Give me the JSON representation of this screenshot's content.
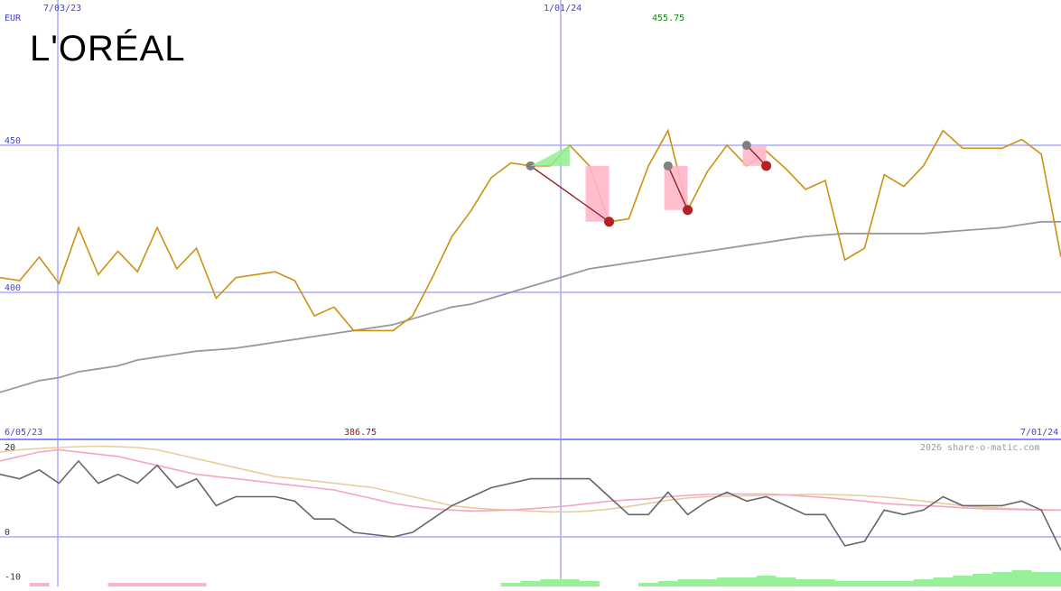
{
  "chart_data": [
    {
      "type": "line",
      "name": "price_panel",
      "currency_label": "EUR",
      "logo_text": "L'ORÉAL",
      "top_date_labels": [
        "7/03/23",
        "1/01/24"
      ],
      "high_label": "455.75",
      "low_label": "386.75",
      "range_start_label": "6/05/23",
      "range_end_label": "7/01/24",
      "y_ticks": [
        450,
        400
      ],
      "ylim": [
        380,
        470
      ],
      "xlim": [
        0,
        55
      ],
      "grid": true,
      "series": [
        {
          "values": [
            405,
            404,
            412,
            403,
            422,
            406,
            414,
            407,
            422,
            408,
            415,
            398,
            405,
            406,
            407,
            404,
            392,
            395,
            387,
            387,
            387,
            392,
            405,
            419,
            428,
            439,
            444,
            443,
            443,
            450,
            443,
            424,
            425,
            443,
            455,
            428,
            441,
            450,
            443,
            448,
            442,
            435,
            438,
            411,
            415,
            440,
            436,
            443,
            455,
            449,
            449,
            449,
            452,
            447,
            412
          ],
          "color": "#cc9111"
        },
        {
          "values": [
            366,
            368,
            370,
            371,
            373,
            374,
            375,
            377,
            378,
            379,
            380,
            380.5,
            381,
            382,
            383,
            384,
            385,
            386,
            387,
            388,
            389,
            391,
            393,
            395,
            396,
            398,
            400,
            402,
            404,
            406,
            408,
            409,
            410,
            411,
            412,
            413,
            414,
            415,
            416,
            417,
            418,
            419,
            419.5,
            420,
            420,
            420,
            420,
            420,
            420.5,
            421,
            421.5,
            422,
            423,
            424,
            424
          ],
          "color": "#999999"
        }
      ],
      "annotations": {
        "pairs": [
          {
            "from_index": 27,
            "to_index": 31,
            "from_value": 443,
            "to_value": 424
          },
          {
            "from_index": 34,
            "to_index": 35,
            "from_value": 443,
            "to_value": 428
          },
          {
            "from_index": 38,
            "to_index": 39,
            "from_value": 450,
            "to_value": 443
          }
        ]
      },
      "watermark": "2026 share-o-matic.com"
    },
    {
      "type": "line",
      "name": "oscillator_panel",
      "y_ticks": [
        20,
        0,
        -10
      ],
      "ylim": [
        -11,
        21
      ],
      "xlim": [
        0,
        55
      ],
      "grid": true,
      "series": [
        {
          "color": "#666666",
          "values": [
            14,
            13,
            15,
            12,
            17,
            12,
            14,
            12,
            16,
            11,
            13,
            7,
            9,
            9,
            9,
            8,
            4,
            4,
            1,
            0.5,
            0,
            1,
            4,
            7,
            9,
            11,
            12,
            13,
            13,
            13,
            13,
            9,
            5,
            5,
            10,
            5,
            8,
            10,
            8,
            9,
            7,
            5,
            5,
            -2,
            -1,
            6,
            5,
            6,
            9,
            7,
            7,
            7,
            8,
            6,
            -3
          ]
        },
        {
          "color": "#f4a6c0",
          "values": [
            17,
            18,
            19,
            19.5,
            19,
            18.5,
            18,
            17,
            16,
            15,
            14,
            13.5,
            13,
            12.5,
            12,
            11.5,
            11,
            10.5,
            9.5,
            8.5,
            7.5,
            6.8,
            6.3,
            6,
            5.8,
            5.9,
            6,
            6.3,
            6.6,
            7,
            7.5,
            8,
            8.3,
            8.5,
            9,
            9.3,
            9.5,
            9.6,
            9.6,
            9.6,
            9.4,
            9.1,
            8.8,
            8.4,
            8,
            7.5,
            7.2,
            7,
            6.8,
            6.5,
            6.3,
            6.2,
            6.1,
            6,
            6
          ]
        },
        {
          "color": "#e8cc9a",
          "values": [
            19,
            19.5,
            19.8,
            20,
            20.2,
            20.3,
            20.2,
            20,
            19.5,
            18.5,
            17.5,
            16.5,
            15.5,
            14.5,
            13.5,
            13,
            12.5,
            12,
            11.5,
            11,
            10,
            9,
            8,
            7,
            6.5,
            6.2,
            6,
            5.8,
            5.6,
            5.6,
            5.8,
            6.2,
            6.8,
            7.5,
            8.2,
            8.7,
            9,
            9.1,
            9.2,
            9.3,
            9.4,
            9.5,
            9.5,
            9.4,
            9.2,
            8.9,
            8.5,
            8,
            7.5,
            7,
            6.6,
            6.4,
            6.2,
            6.1,
            6
          ]
        }
      ],
      "bars": [
        {
          "index": 2,
          "value": -1,
          "color": "#f4b6c8"
        },
        {
          "index": 6,
          "value": -1,
          "color": "#f4b6c8"
        },
        {
          "index": 7,
          "value": -1,
          "color": "#f4b6c8"
        },
        {
          "index": 8,
          "value": -1,
          "color": "#f4b6c8"
        },
        {
          "index": 9,
          "value": -1,
          "color": "#f4b6c8"
        },
        {
          "index": 10,
          "value": -1,
          "color": "#f4b6c8"
        },
        {
          "index": 26,
          "value": 1,
          "color": "#98f098"
        },
        {
          "index": 27,
          "value": 1.5,
          "color": "#98f098"
        },
        {
          "index": 28,
          "value": 2,
          "color": "#98f098"
        },
        {
          "index": 29,
          "value": 2,
          "color": "#98f098"
        },
        {
          "index": 30,
          "value": 1.5,
          "color": "#98f098"
        },
        {
          "index": 33,
          "value": 1,
          "color": "#98f098"
        },
        {
          "index": 34,
          "value": 1.5,
          "color": "#98f098"
        },
        {
          "index": 35,
          "value": 2,
          "color": "#98f098"
        },
        {
          "index": 36,
          "value": 2,
          "color": "#98f098"
        },
        {
          "index": 37,
          "value": 2.5,
          "color": "#98f098"
        },
        {
          "index": 38,
          "value": 2.5,
          "color": "#98f098"
        },
        {
          "index": 39,
          "value": 3,
          "color": "#98f098"
        },
        {
          "index": 40,
          "value": 2.5,
          "color": "#98f098"
        },
        {
          "index": 41,
          "value": 2,
          "color": "#98f098"
        },
        {
          "index": 42,
          "value": 2,
          "color": "#98f098"
        },
        {
          "index": 43,
          "value": 1.5,
          "color": "#98f098"
        },
        {
          "index": 44,
          "value": 1.5,
          "color": "#98f098"
        },
        {
          "index": 45,
          "value": 1.5,
          "color": "#98f098"
        },
        {
          "index": 46,
          "value": 1.5,
          "color": "#98f098"
        },
        {
          "index": 47,
          "value": 2,
          "color": "#98f098"
        },
        {
          "index": 48,
          "value": 2.5,
          "color": "#98f098"
        },
        {
          "index": 49,
          "value": 3,
          "color": "#98f098"
        },
        {
          "index": 50,
          "value": 3.5,
          "color": "#98f098"
        },
        {
          "index": 51,
          "value": 4,
          "color": "#98f098"
        },
        {
          "index": 52,
          "value": 4.5,
          "color": "#98f098"
        },
        {
          "index": 53,
          "value": 4,
          "color": "#98f098"
        },
        {
          "index": 54,
          "value": 4,
          "color": "#98f098"
        }
      ]
    }
  ]
}
